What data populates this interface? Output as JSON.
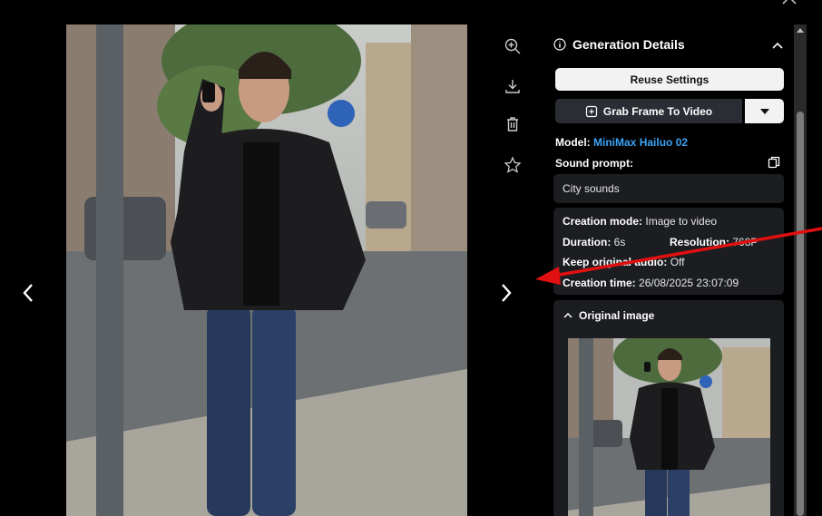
{
  "panel": {
    "title": "Generation Details",
    "reuse_label": "Reuse Settings",
    "grab_label": "Grab Frame To Video",
    "model_label": "Model:",
    "model_value": "MiniMax Hailuo 02",
    "sound_label": "Sound prompt:",
    "sound_value": "City sounds",
    "creation_mode_label": "Creation mode:",
    "creation_mode_value": "Image to video",
    "duration_label": "Duration:",
    "duration_value": "6s",
    "resolution_label": "Resolution:",
    "resolution_value": "768P",
    "keep_audio_label": "Keep original audio:",
    "keep_audio_value": "Off",
    "creation_time_label": "Creation time:",
    "creation_time_value": "26/08/2025 23:07:09",
    "original_image_label": "Original image"
  },
  "icons": {
    "zoom": "zoom-in-icon",
    "download": "download-icon",
    "delete": "trash-icon",
    "favorite": "star-icon",
    "prev": "chevron-left-icon",
    "next": "chevron-right-icon",
    "close": "close-icon"
  },
  "colors": {
    "accent": "#3ba3f5",
    "annotation_arrow": "#e01010",
    "panel_box": "#1b1d21"
  }
}
